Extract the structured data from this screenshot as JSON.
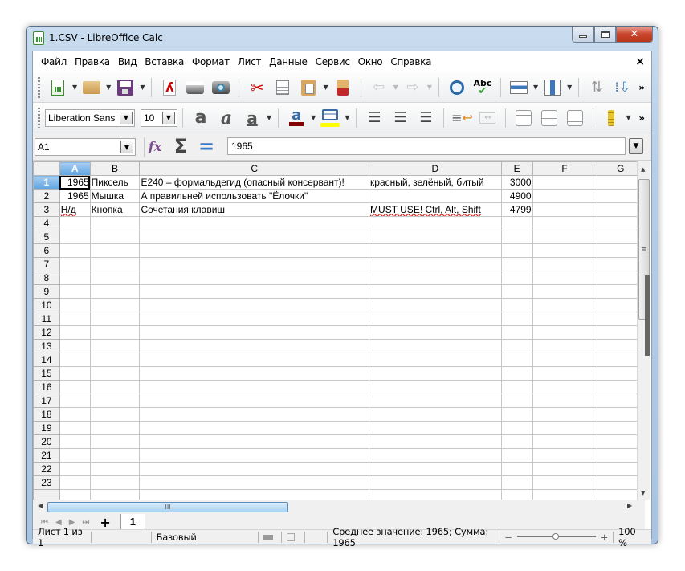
{
  "window": {
    "title": "1.CSV - LibreOffice Calc",
    "controls": {
      "minimize": "—",
      "maximize": "▫",
      "close": "✕"
    }
  },
  "menu": {
    "items": [
      "Файл",
      "Правка",
      "Вид",
      "Вставка",
      "Формат",
      "Лист",
      "Данные",
      "Сервис",
      "Окно",
      "Справка"
    ],
    "close_doc": "×"
  },
  "toolbar_standard": {
    "icons": [
      "new-spreadsheet-icon",
      "open-folder-icon",
      "save-icon",
      "export-pdf-icon",
      "print-icon",
      "print-preview-icon",
      "cut-icon",
      "copy-icon",
      "paste-icon",
      "clone-formatting-icon",
      "undo-icon",
      "redo-icon",
      "find-replace-icon",
      "spellcheck-icon",
      "insert-row-icon",
      "insert-column-icon",
      "sort-icon",
      "sort-descending-icon"
    ],
    "more": "»"
  },
  "toolbar_formatting": {
    "font_name": "Liberation Sans",
    "font_size": "10",
    "font_color": "#800000",
    "highlight_color": "#ffff00",
    "icons": [
      "bold-icon",
      "italic-icon",
      "underline-icon",
      "font-color-icon",
      "highlight-icon",
      "align-left-icon",
      "align-center-icon",
      "align-right-icon",
      "wrap-text-icon",
      "merge-cells-icon",
      "align-top-icon",
      "align-middle-icon",
      "align-bottom-icon",
      "currency-icon"
    ],
    "more": "»"
  },
  "formula_bar": {
    "cell_ref": "A1",
    "content": "1965",
    "sum_symbol": "Σ",
    "equals_symbol": "="
  },
  "sheet": {
    "columns": [
      "A",
      "B",
      "C",
      "D",
      "E",
      "F",
      "G"
    ],
    "selected_column": "A",
    "selected_row": 1,
    "rows": [
      {
        "n": "1",
        "cells": [
          "1965",
          "Пиксель",
          "E240 – формальдегид (опасный консервант)!",
          "красный, зелёный, битый",
          "3000",
          "",
          ""
        ]
      },
      {
        "n": "2",
        "cells": [
          "1965",
          "Мышка",
          "А правильней использовать \"Ёлочки\"",
          "",
          "4900",
          "",
          ""
        ]
      },
      {
        "n": "3",
        "cells": [
          "Н/д",
          "Кнопка",
          "Сочетания клавиш",
          "MUST USE! Ctrl, Alt, Shift",
          "4799",
          "",
          ""
        ]
      },
      {
        "n": "4",
        "cells": [
          "",
          "",
          "",
          "",
          "",
          "",
          ""
        ]
      },
      {
        "n": "5",
        "cells": [
          "",
          "",
          "",
          "",
          "",
          "",
          ""
        ]
      },
      {
        "n": "6",
        "cells": [
          "",
          "",
          "",
          "",
          "",
          "",
          ""
        ]
      },
      {
        "n": "7",
        "cells": [
          "",
          "",
          "",
          "",
          "",
          "",
          ""
        ]
      },
      {
        "n": "8",
        "cells": [
          "",
          "",
          "",
          "",
          "",
          "",
          ""
        ]
      },
      {
        "n": "9",
        "cells": [
          "",
          "",
          "",
          "",
          "",
          "",
          ""
        ]
      },
      {
        "n": "10",
        "cells": [
          "",
          "",
          "",
          "",
          "",
          "",
          ""
        ]
      },
      {
        "n": "11",
        "cells": [
          "",
          "",
          "",
          "",
          "",
          "",
          ""
        ]
      },
      {
        "n": "12",
        "cells": [
          "",
          "",
          "",
          "",
          "",
          "",
          ""
        ]
      },
      {
        "n": "13",
        "cells": [
          "",
          "",
          "",
          "",
          "",
          "",
          ""
        ]
      },
      {
        "n": "14",
        "cells": [
          "",
          "",
          "",
          "",
          "",
          "",
          ""
        ]
      },
      {
        "n": "15",
        "cells": [
          "",
          "",
          "",
          "",
          "",
          "",
          ""
        ]
      },
      {
        "n": "16",
        "cells": [
          "",
          "",
          "",
          "",
          "",
          "",
          ""
        ]
      },
      {
        "n": "17",
        "cells": [
          "",
          "",
          "",
          "",
          "",
          "",
          ""
        ]
      },
      {
        "n": "18",
        "cells": [
          "",
          "",
          "",
          "",
          "",
          "",
          ""
        ]
      },
      {
        "n": "19",
        "cells": [
          "",
          "",
          "",
          "",
          "",
          "",
          ""
        ]
      },
      {
        "n": "20",
        "cells": [
          "",
          "",
          "",
          "",
          "",
          "",
          ""
        ]
      },
      {
        "n": "21",
        "cells": [
          "",
          "",
          "",
          "",
          "",
          "",
          ""
        ]
      },
      {
        "n": "22",
        "cells": [
          "",
          "",
          "",
          "",
          "",
          "",
          ""
        ]
      },
      {
        "n": "23",
        "cells": [
          "",
          "",
          "",
          "",
          "",
          "",
          ""
        ]
      },
      {
        "n": "",
        "cells": [
          "",
          "",
          "",
          "",
          "",
          "",
          ""
        ]
      }
    ]
  },
  "sheet_tabs": {
    "add": "+",
    "tabs": [
      "1"
    ]
  },
  "status_bar": {
    "sheet_info": "Лист 1 из 1",
    "page_style": "Базовый",
    "summary": "Среднее значение: 1965; Сумма: 1965",
    "zoom_minus": "−",
    "zoom_plus": "+",
    "zoom_level": "100 %",
    "zoom_percent": 100
  }
}
